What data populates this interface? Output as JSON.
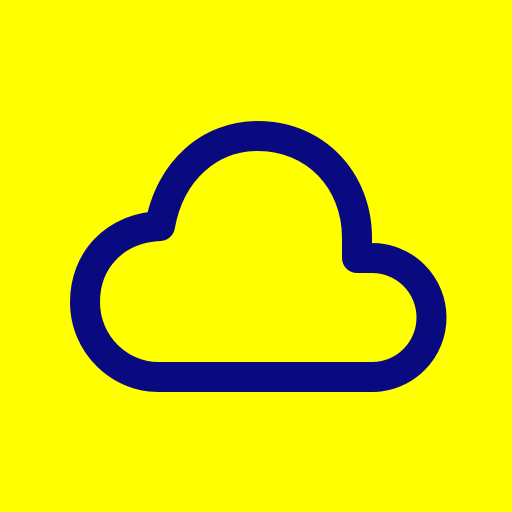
{
  "icon": {
    "name": "cloud-icon",
    "style": "outline"
  },
  "colors": {
    "background": "#FFFF00",
    "stroke": "#0A0A80"
  }
}
